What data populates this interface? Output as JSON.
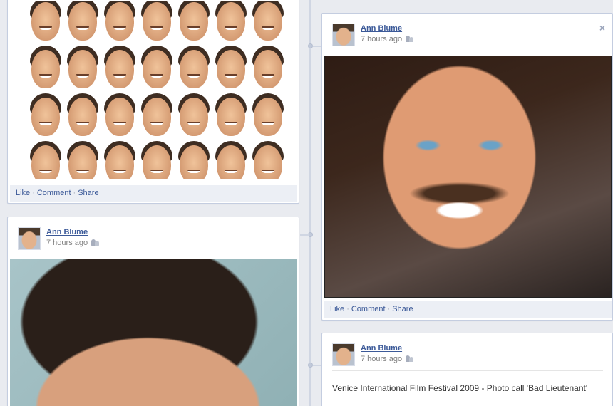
{
  "timeline": {
    "stories": [
      {
        "actions": {
          "like": "Like",
          "comment": "Comment",
          "share": "Share"
        }
      },
      {
        "author": "Ann Blume",
        "time": "7 hours ago",
        "privacy_icon": "friends-icon",
        "actions": {
          "like": "Like",
          "comment": "Comment",
          "share": "Share"
        }
      },
      {
        "author": "Ann Blume",
        "time": "7 hours ago",
        "privacy_icon": "friends-icon"
      },
      {
        "author": "Ann Blume",
        "time": "7 hours ago",
        "privacy_icon": "friends-icon",
        "description": "Venice International Film Festival 2009 - Photo call 'Bad Lieutenant'"
      }
    ],
    "close_label": "×",
    "separator": "·"
  },
  "colors": {
    "link": "#3b5998",
    "action_bar": "#eceff5",
    "background": "#e9ebf0",
    "muted_text": "#808080"
  }
}
